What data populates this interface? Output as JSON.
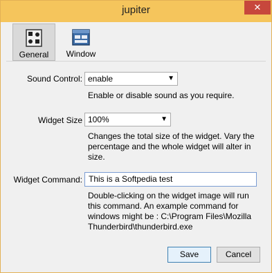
{
  "window": {
    "title": "jupiter",
    "close_glyph": "✕"
  },
  "toolbar": {
    "tabs": [
      {
        "label": "General",
        "icon": "speaker-settings-icon",
        "active": true
      },
      {
        "label": "Window",
        "icon": "window-icon",
        "active": false
      }
    ]
  },
  "general": {
    "sound_control": {
      "label": "Sound Control:",
      "value": "enable",
      "help": "Enable or disable sound as you require."
    },
    "widget_size": {
      "label": "Widget Size",
      "value": "100%",
      "help": "Changes the total size of the widget. Vary the percentage and the whole widget will alter in size."
    },
    "widget_command": {
      "label": "Widget Command:",
      "value": "This is a Softpedia test",
      "help": "Double-clicking on the widget image will run this command. An example command for windows might be : C:\\Program Files\\Mozilla Thunderbird\\thunderbird.exe"
    }
  },
  "footer": {
    "save_label": "Save",
    "cancel_label": "Cancel"
  },
  "colors": {
    "titlebar": "#f5c55c",
    "close": "#c7473c",
    "accent": "#3c7fb1"
  }
}
